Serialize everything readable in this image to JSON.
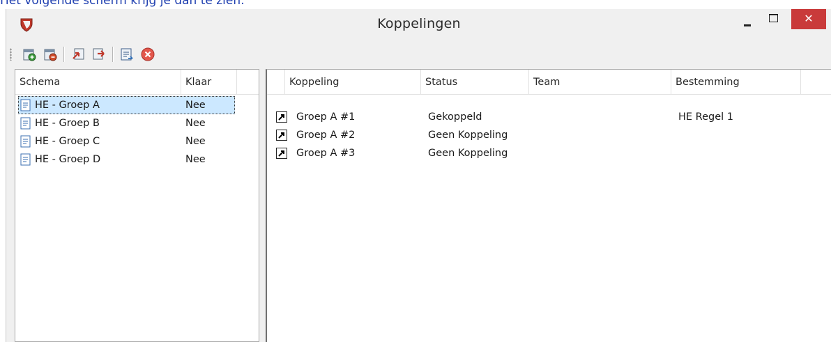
{
  "caption": "Het volgende scherm krijg je dan te zien:",
  "window": {
    "title": "Koppelingen",
    "app_icon": "shield-icon",
    "controls": {
      "minimize": "minimize-icon",
      "maximize": "maximize-icon",
      "close": "✕"
    }
  },
  "toolbar": {
    "buttons": [
      {
        "name": "add-schema-button",
        "icon": "add-document-icon"
      },
      {
        "name": "remove-schema-button",
        "icon": "remove-document-icon"
      },
      {
        "name": "import-button",
        "icon": "import-icon"
      },
      {
        "name": "export-button",
        "icon": "export-icon"
      },
      {
        "name": "schema-link-button",
        "icon": "schema-icon"
      },
      {
        "name": "delete-button",
        "icon": "delete-circle-icon"
      }
    ]
  },
  "schemas": {
    "columns": {
      "schema": "Schema",
      "klaar": "Klaar"
    },
    "rows": [
      {
        "schema": "HE - Groep A",
        "klaar": "Nee"
      },
      {
        "schema": "HE - Groep B",
        "klaar": "Nee"
      },
      {
        "schema": "HE - Groep C",
        "klaar": "Nee"
      },
      {
        "schema": "HE - Groep D",
        "klaar": "Nee"
      }
    ],
    "selected_index": 0
  },
  "koppelingen": {
    "columns": {
      "koppeling": "Koppeling",
      "status": "Status",
      "team": "Team",
      "bestemming": "Bestemming"
    },
    "rows": [
      {
        "koppeling": "Groep A #1",
        "status": "Gekoppeld",
        "team": "",
        "bestemming": "HE Regel 1"
      },
      {
        "koppeling": "Groep A #2",
        "status": "Geen Koppeling",
        "team": "",
        "bestemming": ""
      },
      {
        "koppeling": "Groep A #3",
        "status": "Geen Koppeling",
        "team": "",
        "bestemming": ""
      }
    ]
  },
  "colors": {
    "caption": "#1f3fb0",
    "close_button": "#c93a3a",
    "selection": "#cce8ff"
  }
}
